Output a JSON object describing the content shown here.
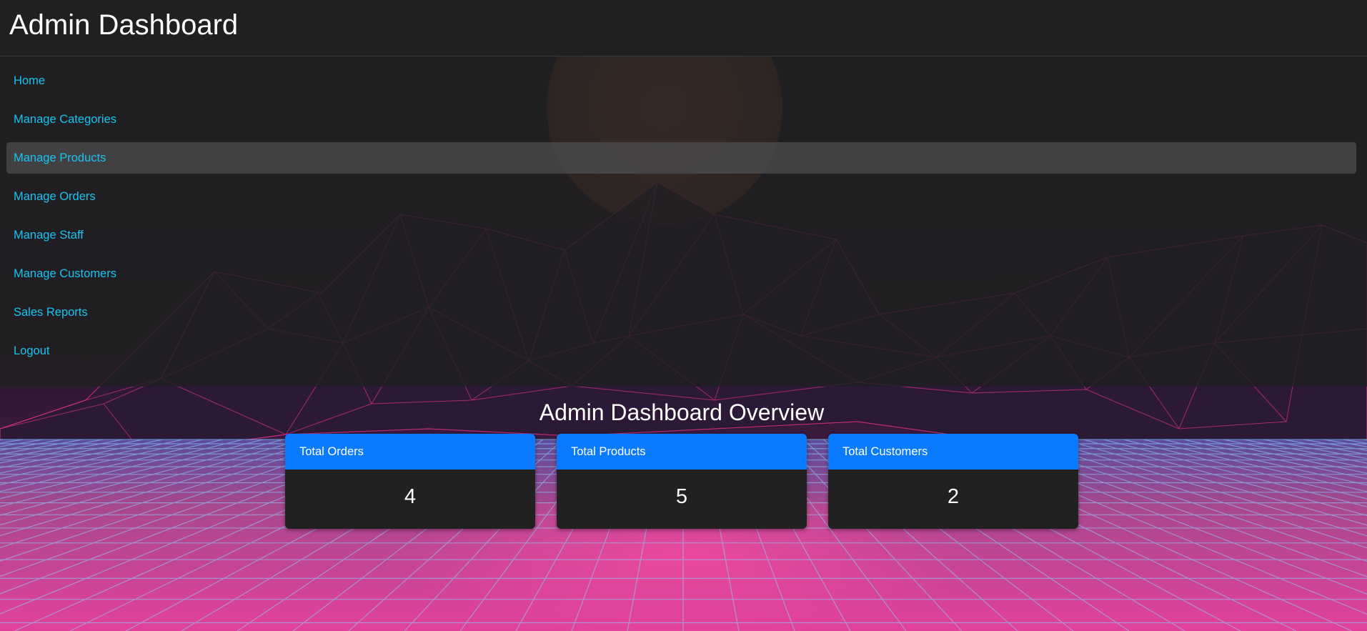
{
  "header": {
    "title": "Admin Dashboard"
  },
  "sidebar": {
    "items": [
      {
        "label": "Home"
      },
      {
        "label": "Manage Categories"
      },
      {
        "label": "Manage Products",
        "active": true
      },
      {
        "label": "Manage Orders"
      },
      {
        "label": "Manage Staff"
      },
      {
        "label": "Manage Customers"
      },
      {
        "label": "Sales Reports"
      },
      {
        "label": "Logout"
      }
    ]
  },
  "main": {
    "title": "Admin Dashboard Overview",
    "cards": [
      {
        "label": "Total Orders",
        "value": "4"
      },
      {
        "label": "Total Products",
        "value": "5"
      },
      {
        "label": "Total Customers",
        "value": "2"
      }
    ]
  },
  "theme": {
    "link_color": "#19c3f0",
    "card_header_color": "#0a7afe",
    "panel_color": "#202020",
    "grid_color": "#8fd0ff",
    "floor_color": "#e0408f"
  }
}
